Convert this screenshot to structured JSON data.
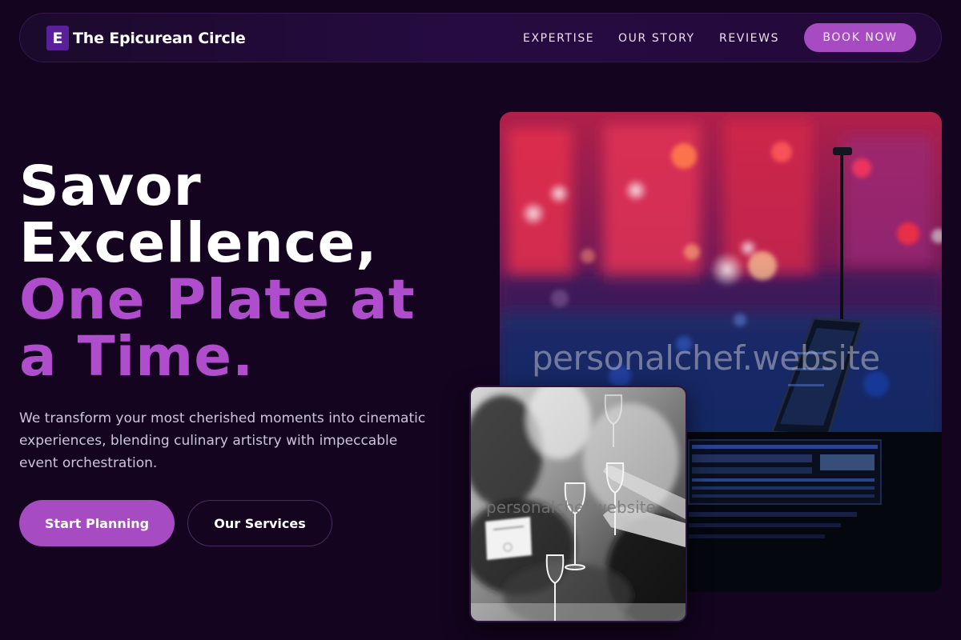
{
  "nav": {
    "brand_letter": "E",
    "brand_name": "The Epicurean Circle",
    "links": [
      "EXPERTISE",
      "OUR STORY",
      "REVIEWS"
    ],
    "cta": "BOOK NOW"
  },
  "hero": {
    "headline_line1": "Savor",
    "headline_line2": "Excellence,",
    "headline_accent": "One Plate at a Time.",
    "subtext": "We transform your most cherished moments into cinematic experiences, blending culinary artistry with impeccable event orchestration.",
    "primary_button": "Start Planning",
    "secondary_button": "Our Services"
  },
  "images": {
    "main_watermark": "personalchef.website",
    "secondary_watermark": "personalchef.website"
  },
  "colors": {
    "background": "#14041f",
    "accent": "#a64bc2",
    "accent_text": "#b04dcc"
  }
}
